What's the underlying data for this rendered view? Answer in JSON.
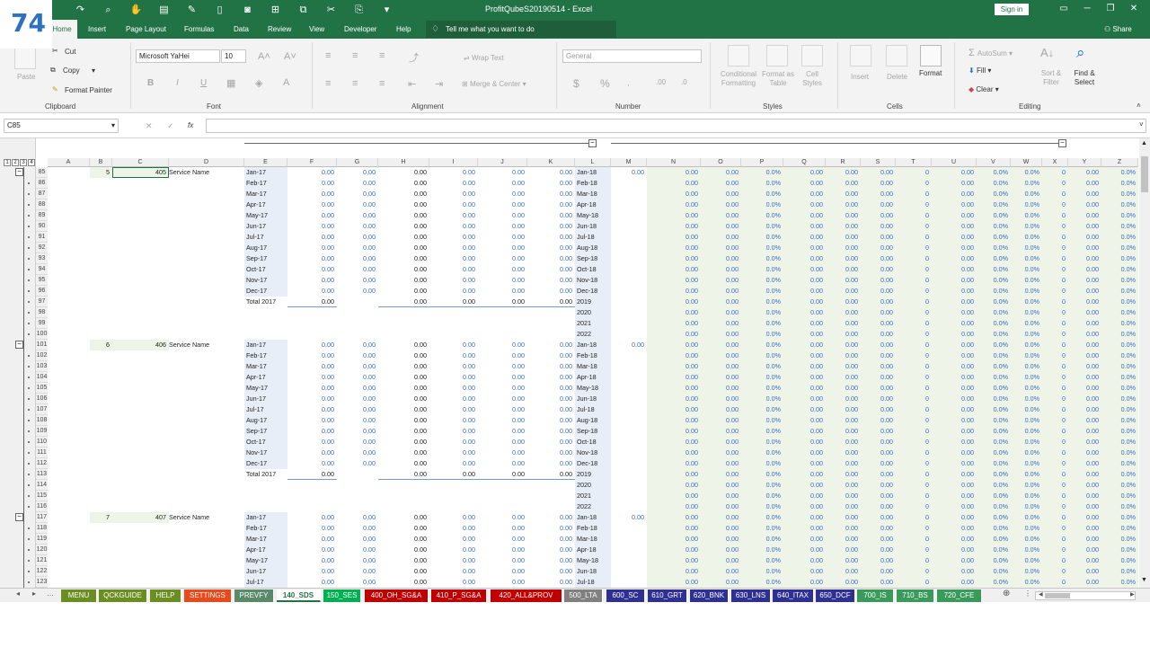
{
  "window": {
    "title": "ProfitQubeS20190514  -  Excel",
    "signin": "Sign in"
  },
  "badge": "74",
  "qat": [
    {
      "icon": "redo-icon",
      "glyph": "↷"
    },
    {
      "icon": "print-preview-icon",
      "glyph": "⌕"
    },
    {
      "icon": "touch-mode-icon",
      "glyph": "✋"
    },
    {
      "icon": "form-icon",
      "glyph": "▤"
    },
    {
      "icon": "tools-icon",
      "glyph": "✎"
    },
    {
      "icon": "document-icon",
      "glyph": "▯"
    },
    {
      "icon": "camera-icon",
      "glyph": "◙"
    },
    {
      "icon": "group-icon",
      "glyph": "⊞"
    },
    {
      "icon": "copy-icon",
      "glyph": "⧉"
    },
    {
      "icon": "cut-icon",
      "glyph": "✂"
    },
    {
      "icon": "paste-icon",
      "glyph": "⎘"
    },
    {
      "icon": "more-icon",
      "glyph": "▾"
    }
  ],
  "tabs": [
    "Home",
    "Insert",
    "Page Layout",
    "Formulas",
    "Data",
    "Review",
    "View",
    "Developer",
    "Help"
  ],
  "tellme": "Tell me what you want to do",
  "share": "Share",
  "ribbon": {
    "clipboard": {
      "paste": "Paste",
      "cut": "Cut",
      "copy": "Copy",
      "painter": "Format Painter",
      "label": "Clipboard"
    },
    "font": {
      "name": "Microsoft YaHei",
      "size": "10",
      "label": "Font",
      "bold": "B",
      "italic": "I",
      "underline": "U"
    },
    "alignment": {
      "wrap": "Wrap Text",
      "merge": "Merge & Center",
      "label": "Alignment"
    },
    "number": {
      "format": "General",
      "label": "Number",
      "currency": "$",
      "percent": "%"
    },
    "styles": {
      "conditional": "Conditional Formatting",
      "format_table": "Format as Table",
      "cell_styles": "Cell Styles",
      "label": "Styles"
    },
    "cells": {
      "insert": "Insert",
      "delete": "Delete",
      "format": "Format",
      "label": "Cells"
    },
    "editing": {
      "autosum": "AutoSum",
      "fill": "Fill",
      "clear": "Clear",
      "sort": "Sort & Filter",
      "find": "Find & Select",
      "label": "Editing"
    }
  },
  "namebox": "C85",
  "fx": "fx",
  "levels": [
    "1",
    "2",
    "3",
    "4"
  ],
  "columns": [
    "A",
    "B",
    "C",
    "D",
    "E",
    "F",
    "G",
    "H",
    "I",
    "J",
    "K",
    "L",
    "M",
    "N",
    "O",
    "P",
    "Q",
    "R",
    "S",
    "T",
    "U",
    "V",
    "W",
    "X",
    "Y",
    "Z"
  ],
  "months17": [
    "Jan-17",
    "Feb-17",
    "Mar-17",
    "Apr-17",
    "May-17",
    "Jun-17",
    "Jul-17",
    "Aug-17",
    "Sep-17",
    "Oct-17",
    "Nov-17",
    "Dec-17",
    "Total 2017"
  ],
  "months18": [
    "Jan-18",
    "Feb-18",
    "Mar-18",
    "Apr-18",
    "May-18",
    "Jun-18",
    "Jul-18",
    "Aug-18",
    "Sep-18",
    "Oct-18",
    "Nov-18",
    "Dec-18",
    "2019",
    "2020",
    "2021",
    "2022"
  ],
  "blocks": [
    {
      "start": 85,
      "num": "5",
      "code": "405",
      "name": "Service Name",
      "rows": 16
    },
    {
      "start": 101,
      "num": "6",
      "code": "406",
      "name": "Service Name",
      "rows": 16
    },
    {
      "start": 117,
      "num": "7",
      "code": "407",
      "name": "Service Name",
      "rows": 7
    }
  ],
  "values": {
    "zero": "0.00",
    "pct": "0.0%",
    "int": "0"
  },
  "sheets": [
    {
      "name": "MENU",
      "color": "#6b8e23"
    },
    {
      "name": "QCKGUIDE",
      "color": "#6b8e23"
    },
    {
      "name": "HELP",
      "color": "#6b8e23"
    },
    {
      "name": "SETTINGS",
      "color": "#e8491d"
    },
    {
      "name": "PREVFY",
      "color": "#5a8a6a"
    },
    {
      "name": "140_SDS",
      "color": "#ffffff"
    },
    {
      "name": "150_SES",
      "color": "#00b050"
    },
    {
      "name": "400_OH_SG&A",
      "color": "#c00000"
    },
    {
      "name": "410_P_SG&A",
      "color": "#c00000"
    },
    {
      "name": "420_ALL&PROV",
      "color": "#c00000"
    },
    {
      "name": "500_LTA",
      "color": "#808080"
    },
    {
      "name": "600_SC",
      "color": "#2e3192"
    },
    {
      "name": "610_GRT",
      "color": "#2e3192"
    },
    {
      "name": "620_BNK",
      "color": "#2e3192"
    },
    {
      "name": "630_LNS",
      "color": "#2e3192"
    },
    {
      "name": "640_ITAX",
      "color": "#2e3192"
    },
    {
      "name": "650_DCF",
      "color": "#2e3192"
    },
    {
      "name": "700_IS",
      "color": "#3a9a5a"
    },
    {
      "name": "710_BS",
      "color": "#3a9a5a"
    },
    {
      "name": "720_CFE",
      "color": "#3a9a5a"
    }
  ]
}
